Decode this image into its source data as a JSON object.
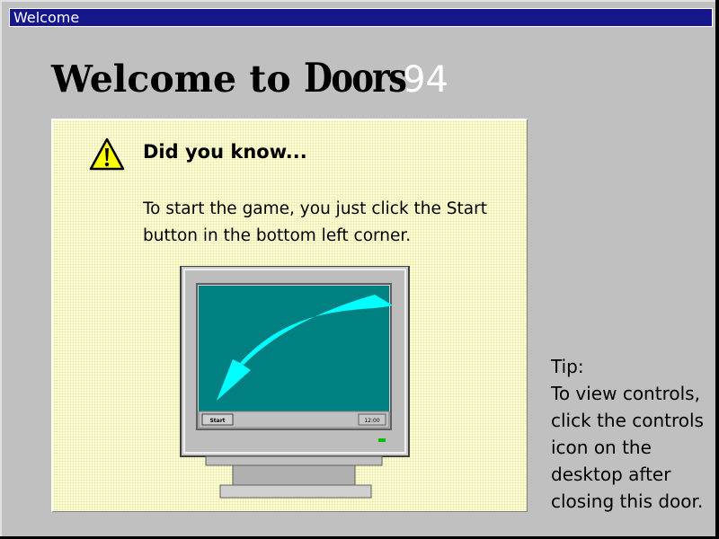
{
  "window": {
    "title": "Welcome"
  },
  "heading": {
    "part1": "Welcome to ",
    "part2": "Doors",
    "part3": "94"
  },
  "tip_panel": {
    "title": "Did you know...",
    "body": "To start the game, you just click the Start button in the bottom left corner.",
    "icon": "warning-icon",
    "illustration": {
      "start_button_label": "Start",
      "clock_label": "12:00"
    }
  },
  "side_tip": {
    "label": "Tip:",
    "text": "To view controls, click the controls icon on the desktop after closing this door."
  },
  "colors": {
    "titlebar": "#15168a",
    "window": "#c0c0c0",
    "panel": "#ffffd2",
    "screen": "#008080",
    "arrow": "#00ffff"
  }
}
